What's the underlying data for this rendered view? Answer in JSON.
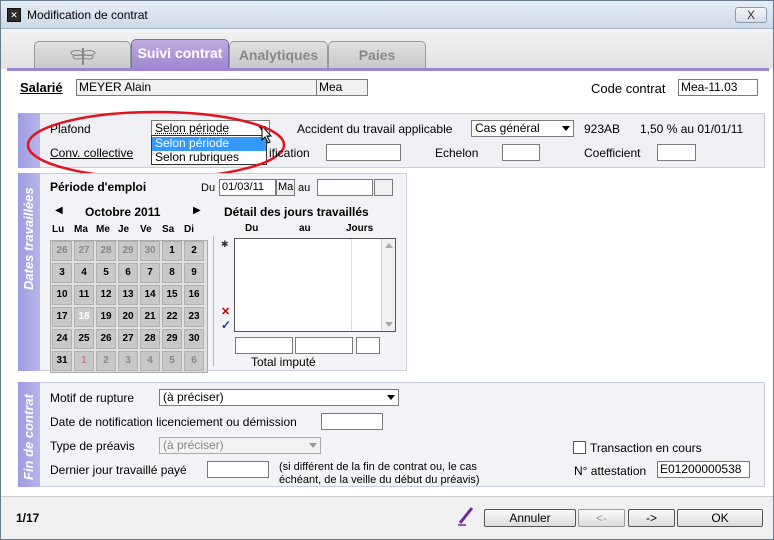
{
  "window": {
    "title": "Modification de contrat",
    "close_label": "X"
  },
  "tabs": [
    {
      "label": ""
    },
    {
      "label": "Suivi contrat",
      "active": true
    },
    {
      "label": "Analytiques"
    },
    {
      "label": "Paies"
    }
  ],
  "header": {
    "salarie_label": "Salarié",
    "salarie_name": "MEYER Alain",
    "salarie_code": "Mea",
    "code_contrat_label": "Code contrat",
    "code_contrat_value": "Mea-11.03"
  },
  "plafond": {
    "label": "Plafond",
    "value": "Selon période",
    "dropdown_options": [
      "Selon période",
      "Selon rubriques"
    ],
    "selected_index": 0
  },
  "accident": {
    "label": "Accident du travail applicable",
    "value": "Cas général",
    "code": "923AB",
    "rate_text": "1,50 % au 01/01/11"
  },
  "conv": {
    "label": "Conv. collective",
    "qualification_partial": "ification",
    "echelon_label": "Echelon",
    "coefficient_label": "Coefficient"
  },
  "dates_section": {
    "vertical_label": "Dates travaillées",
    "periode_label": "Période d'emploi",
    "du_label": "Du",
    "du_value": "01/03/11",
    "du_day": "Ma",
    "au_label": "au",
    "calendar": {
      "month": "Octobre 2011",
      "weekdays": [
        "Lu",
        "Ma",
        "Me",
        "Je",
        "Ve",
        "Sa",
        "Di"
      ],
      "weeks": [
        [
          "26",
          "27",
          "28",
          "29",
          "30",
          "1",
          "2"
        ],
        [
          "3",
          "4",
          "5",
          "6",
          "7",
          "8",
          "9"
        ],
        [
          "10",
          "11",
          "12",
          "13",
          "14",
          "15",
          "16"
        ],
        [
          "17",
          "18",
          "19",
          "20",
          "21",
          "22",
          "23"
        ],
        [
          "24",
          "25",
          "26",
          "27",
          "28",
          "29",
          "30"
        ],
        [
          "31",
          "1",
          "2",
          "3",
          "4",
          "5",
          "6"
        ]
      ]
    },
    "detail_title": "Détail des jours travaillés",
    "detail_cols": [
      "Du",
      "au",
      "Jours"
    ],
    "total_label": "Total imputé"
  },
  "fin_section": {
    "vertical_label": "Fin de contrat",
    "motif_label": "Motif de rupture",
    "motif_value": "(à préciser)",
    "notification_label": "Date de notification licenciement ou démission",
    "preavis_label": "Type de préavis",
    "preavis_value": "(à préciser)",
    "dernier_label": "Dernier jour travaillé payé",
    "dernier_note_1": "(si différent de la fin de contrat ou, le cas",
    "dernier_note_2": "échéant, de la veille du début du préavis)",
    "transaction_label": "Transaction en cours",
    "attestation_label": "N° attestation",
    "attestation_value": "E01200000538"
  },
  "footer": {
    "page": "1/17",
    "annuler": "Annuler",
    "prev": "<-",
    "next": "->",
    "ok": "OK"
  }
}
